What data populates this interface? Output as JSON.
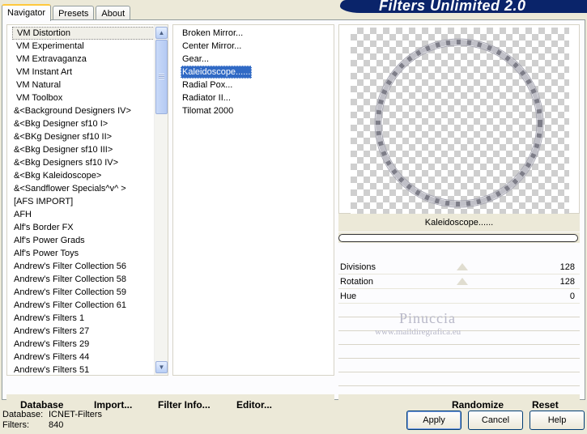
{
  "window": {
    "banner_title": "Filters Unlimited 2.0"
  },
  "tabs": [
    {
      "label": "Navigator",
      "active": true
    },
    {
      "label": "Presets",
      "active": false
    },
    {
      "label": "About",
      "active": false
    }
  ],
  "categories": [
    {
      "label": "VM Distortion",
      "selected": true
    },
    {
      "label": "VM Experimental"
    },
    {
      "label": "VM Extravaganza"
    },
    {
      "label": "VM Instant Art"
    },
    {
      "label": "VM Natural"
    },
    {
      "label": "VM Toolbox"
    },
    {
      "label": "&<Background Designers IV>"
    },
    {
      "label": "&<Bkg Designer sf10 I>"
    },
    {
      "label": "&<BKg Designer sf10 II>"
    },
    {
      "label": "&<Bkg Designer sf10 III>"
    },
    {
      "label": "&<Bkg Designers sf10 IV>"
    },
    {
      "label": "&<Bkg Kaleidoscope>"
    },
    {
      "label": "&<Sandflower Specials^v^ >"
    },
    {
      "label": "[AFS IMPORT]"
    },
    {
      "label": "AFH"
    },
    {
      "label": "Alf's Border FX"
    },
    {
      "label": "Alf's Power Grads"
    },
    {
      "label": "Alf's Power Toys"
    },
    {
      "label": "Andrew's Filter Collection 56"
    },
    {
      "label": "Andrew's Filter Collection 58"
    },
    {
      "label": "Andrew's Filter Collection 59"
    },
    {
      "label": "Andrew's Filter Collection 61"
    },
    {
      "label": "Andrew's Filters 1"
    },
    {
      "label": "Andrew's Filters 27"
    },
    {
      "label": "Andrew's Filters 29"
    },
    {
      "label": "Andrew's Filters 44"
    },
    {
      "label": "Andrew's Filters 51"
    }
  ],
  "filters": [
    {
      "label": "Broken Mirror..."
    },
    {
      "label": "Center Mirror..."
    },
    {
      "label": "Gear..."
    },
    {
      "label": "Kaleidoscope......",
      "selected": true
    },
    {
      "label": "Radial Pox..."
    },
    {
      "label": "Radiator II..."
    },
    {
      "label": "Tilomat 2000"
    }
  ],
  "preview": {
    "filter_name": "Kaleidoscope......"
  },
  "parameters": [
    {
      "label": "Divisions",
      "value": "128"
    },
    {
      "label": "Rotation",
      "value": "128"
    },
    {
      "label": "Hue",
      "value": "0"
    }
  ],
  "watermark": {
    "name": "Pinuccia",
    "url": "www.maildiregrafica.eu"
  },
  "left_commands": {
    "database": "Database",
    "import": "Import...",
    "filter_info": "Filter Info...",
    "editor": "Editor..."
  },
  "right_commands": {
    "randomize": "Randomize",
    "reset": "Reset"
  },
  "footer": {
    "database_label": "Database:",
    "database_value": "ICNET-Filters",
    "filters_label": "Filters:",
    "filters_value": "840"
  },
  "buttons": {
    "apply": "Apply",
    "cancel": "Cancel",
    "help": "Help"
  },
  "colors": {
    "banner": "#0a246a",
    "selection": "#316ac5",
    "window_bg": "#ece9d8"
  }
}
